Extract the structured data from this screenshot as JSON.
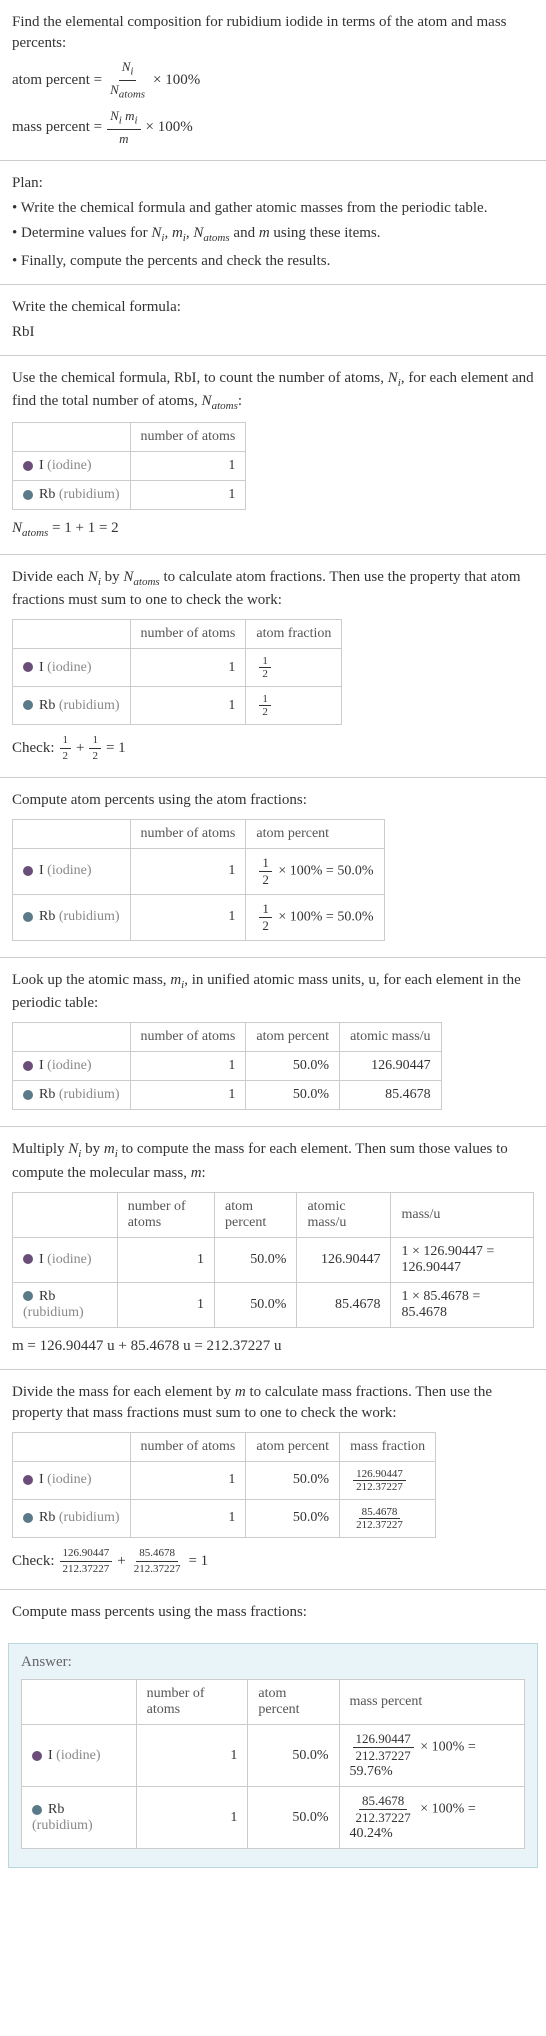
{
  "intro": {
    "line1": "Find the elemental composition for rubidium iodide in terms of the atom and mass percents:",
    "atomPercentLabel": "atom percent =",
    "atomNumer": "N_i",
    "atomDenom": "N_atoms",
    "times100a": "× 100%",
    "massPercentLabel": "mass percent =",
    "massNumer": "N_i m_i",
    "massDenom": "m",
    "times100b": "× 100%"
  },
  "plan": {
    "title": "Plan:",
    "b1": "• Write the chemical formula and gather atomic masses from the periodic table.",
    "b2pre": "• Determine values for ",
    "b2vars": "N_i, m_i, N_atoms",
    "b2post": " and m using these items.",
    "b3": "• Finally, compute the percents and check the results."
  },
  "s1": {
    "title": "Write the chemical formula:",
    "formula": "RbI"
  },
  "s2": {
    "textA": "Use the chemical formula, RbI, to count the number of atoms, ",
    "ni": "N_i",
    "textB": ", for each element and find the total number of atoms, ",
    "na": "N_atoms",
    "textC": ":",
    "h_atoms": "number of atoms",
    "i_name": "I (iodine)",
    "rb_name": "Rb (rubidium)",
    "i_n": "1",
    "rb_n": "1",
    "sumLabel": "N_atoms",
    "sumExpr": " = 1 + 1 = 2"
  },
  "s3": {
    "text": "Divide each N_i by N_atoms to calculate atom fractions. Then use the property that atom fractions must sum to one to check the work:",
    "h_atoms": "number of atoms",
    "h_frac": "atom fraction",
    "i_n": "1",
    "rb_n": "1",
    "half_n": "1",
    "half_d": "2",
    "check": "Check: ",
    "checkEnd": " = 1"
  },
  "s4": {
    "text": "Compute atom percents using the atom fractions:",
    "h_atoms": "number of atoms",
    "h_pct": "atom percent",
    "i_n": "1",
    "rb_n": "1",
    "expr_i": " × 100% = 50.0%",
    "expr_rb": " × 100% = 50.0%"
  },
  "s5": {
    "text": "Look up the atomic mass, m_i, in unified atomic mass units, u, for each element in the periodic table:",
    "h_atoms": "number of atoms",
    "h_pct": "atom percent",
    "h_mass": "atomic mass/u",
    "i_n": "1",
    "i_pct": "50.0%",
    "i_m": "126.90447",
    "rb_n": "1",
    "rb_pct": "50.0%",
    "rb_m": "85.4678"
  },
  "s6": {
    "text": "Multiply N_i by m_i to compute the mass for each element. Then sum those values to compute the molecular mass, m:",
    "h_atoms": "number of atoms",
    "h_pct": "atom percent",
    "h_amass": "atomic mass/u",
    "h_mass": "mass/u",
    "i_n": "1",
    "i_pct": "50.0%",
    "i_am": "126.90447",
    "i_mass": "1 × 126.90447 = 126.90447",
    "rb_n": "1",
    "rb_pct": "50.0%",
    "rb_am": "85.4678",
    "rb_mass": "1 × 85.4678 = 85.4678",
    "sum": "m = 126.90447 u + 85.4678 u = 212.37227 u"
  },
  "s7": {
    "text": "Divide the mass for each element by m to calculate mass fractions. Then use the property that mass fractions must sum to one to check the work:",
    "h_atoms": "number of atoms",
    "h_pct": "atom percent",
    "h_mf": "mass fraction",
    "i_n": "1",
    "i_pct": "50.0%",
    "i_num": "126.90447",
    "denom": "212.37227",
    "rb_n": "1",
    "rb_pct": "50.0%",
    "rb_num": "85.4678",
    "check": "Check: ",
    "plus": " + ",
    "checkEnd": " = 1"
  },
  "s8": {
    "text": "Compute mass percents using the mass fractions:"
  },
  "answer": {
    "label": "Answer:",
    "h_atoms": "number of atoms",
    "h_apct": "atom percent",
    "h_mpct": "mass percent",
    "i_n": "1",
    "i_apct": "50.0%",
    "i_num": "126.90447",
    "denom": "212.37227",
    "i_tail": " × 100% = 59.76%",
    "rb_n": "1",
    "rb_apct": "50.0%",
    "rb_num": "85.4678",
    "rb_tail": " × 100% = 40.24%"
  },
  "chart_data": {
    "type": "table",
    "compound": "RbI",
    "elements": [
      {
        "symbol": "I",
        "name": "iodine",
        "atoms": 1,
        "atom_fraction": 0.5,
        "atom_percent": 50.0,
        "atomic_mass_u": 126.90447,
        "mass_u": 126.90447,
        "mass_fraction": 0.5976,
        "mass_percent": 59.76
      },
      {
        "symbol": "Rb",
        "name": "rubidium",
        "atoms": 1,
        "atom_fraction": 0.5,
        "atom_percent": 50.0,
        "atomic_mass_u": 85.4678,
        "mass_u": 85.4678,
        "mass_fraction": 0.4024,
        "mass_percent": 40.24
      }
    ],
    "N_atoms": 2,
    "molecular_mass_u": 212.37227
  }
}
